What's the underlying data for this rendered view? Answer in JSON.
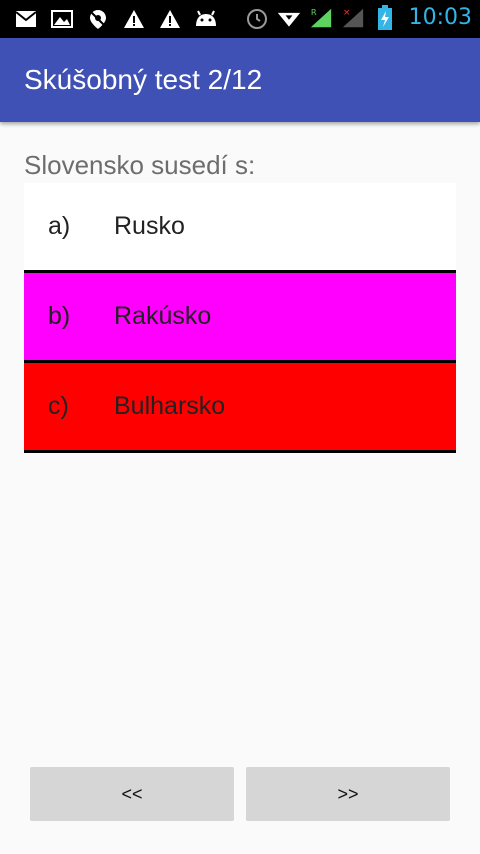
{
  "status_bar": {
    "time": "10:03",
    "left_icons": [
      "mail-icon",
      "image-icon",
      "location-off-icon",
      "warning-icon",
      "warning-icon",
      "android-icon"
    ],
    "right_icons": [
      "alarm-icon",
      "wifi-icon",
      "signal-icon",
      "signal-no-service-icon",
      "battery-charging-icon"
    ],
    "time_color": "#33b5e5"
  },
  "app_bar": {
    "title": "Skúšobný test 2/12",
    "color": "#3f51b5"
  },
  "question": {
    "text": "Slovensko susedí s:"
  },
  "answers": [
    {
      "letter": "a)",
      "label": "Rusko",
      "bg": "#ffffff"
    },
    {
      "letter": "b)",
      "label": "Rakúsko",
      "bg": "#ff00ff"
    },
    {
      "letter": "c)",
      "label": "Bulharsko",
      "bg": "#ff0000"
    }
  ],
  "nav": {
    "prev_label": "<<",
    "next_label": ">>"
  }
}
